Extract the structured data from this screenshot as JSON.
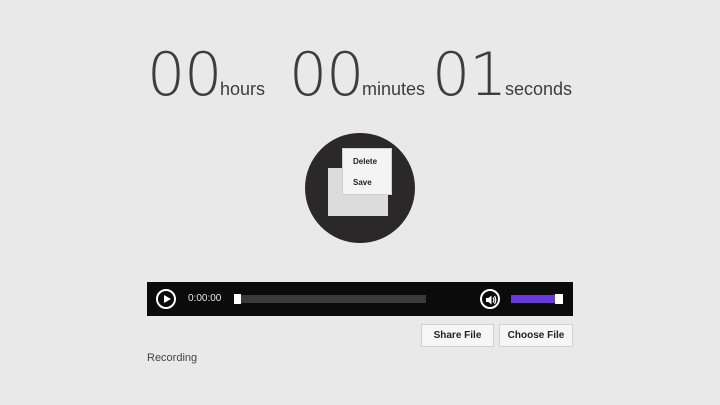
{
  "timer": {
    "hours": "00",
    "hours_label": "hours",
    "minutes": "00",
    "minutes_label": "minutes",
    "seconds": "01",
    "seconds_label": "seconds"
  },
  "context_menu": {
    "items": [
      "Delete",
      "Save"
    ]
  },
  "player": {
    "current_time": "0:00:00",
    "seek_progress": 0,
    "volume_level": 0.85,
    "accent_color": "#6a3ad8"
  },
  "buttons": {
    "share": "Share File",
    "choose": "Choose File"
  },
  "status": "Recording"
}
